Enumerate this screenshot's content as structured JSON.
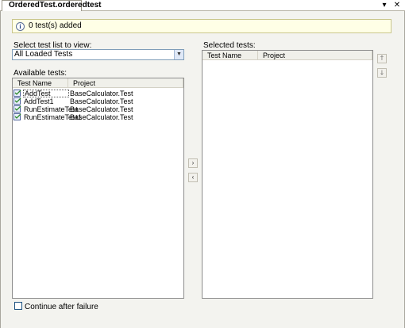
{
  "tab": {
    "title": "OrderedTest.orderedtest"
  },
  "window_controls": {
    "dropdown": "▾",
    "close": "✕"
  },
  "infobar": {
    "icon": "info-icon",
    "glyph": "i",
    "message": "0 test(s) added"
  },
  "test_list": {
    "label": "Select test list to view:",
    "selected": "All Loaded Tests",
    "arrow": "▼"
  },
  "available": {
    "label": "Available tests:",
    "columns": [
      "Test Name",
      "Project"
    ],
    "rows": [
      {
        "name": "AddTest",
        "project": "BaseCalculator.Test"
      },
      {
        "name": "AddTest1",
        "project": "BaseCalculator.Test"
      },
      {
        "name": "RunEstimateTest",
        "project": "BaseCalculator.Test"
      },
      {
        "name": "RunEstimateTest1",
        "project": "BaseCalculator.Test"
      }
    ]
  },
  "selected_tests": {
    "label": "Selected tests:",
    "columns": [
      "Test Name",
      "Project"
    ]
  },
  "buttons": {
    "move_up": "🡑",
    "move_down": "🡓",
    "add": "›",
    "remove": "‹"
  },
  "options": {
    "continue_after_failure": "Continue after failure",
    "checked": false
  }
}
